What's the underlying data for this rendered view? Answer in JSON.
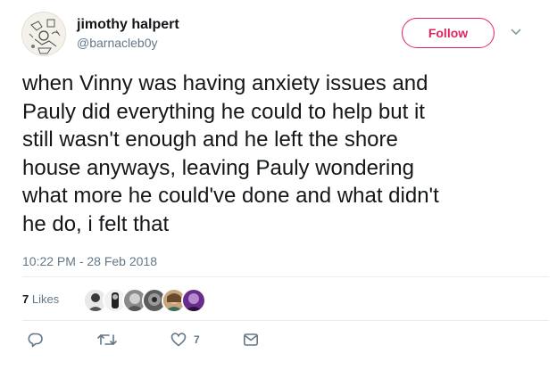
{
  "user": {
    "display_name": "jimothy halpert",
    "handle": "@barnacleb0y",
    "avatar_icon": "sketch-avatar-icon"
  },
  "follow_button": {
    "label": "Follow",
    "color": "#e0245e"
  },
  "menu_icon": "chevron-down-icon",
  "tweet": {
    "text": "when Vinny was having anxiety issues and\nPauly did everything he could to help but it\nstill wasn't enough and he left the shore\nhouse anyways, leaving Pauly wondering\nwhat more he could've done and what didn't\nhe do, i felt that",
    "timestamp": "10:22 PM - 28 Feb 2018"
  },
  "likes": {
    "count": "7",
    "label": "Likes",
    "liker_avatars": [
      "liker-avatar-1",
      "liker-avatar-2",
      "liker-avatar-3",
      "liker-avatar-4",
      "liker-avatar-5",
      "liker-avatar-6"
    ]
  },
  "actions": {
    "reply_icon": "reply-icon",
    "retweet_icon": "retweet-icon",
    "like_icon": "heart-icon",
    "like_count": "7",
    "dm_icon": "envelope-icon"
  },
  "colors": {
    "text_primary": "#14171a",
    "text_secondary": "#657786",
    "divider": "#e6ecf0",
    "action_icon": "#657786"
  }
}
